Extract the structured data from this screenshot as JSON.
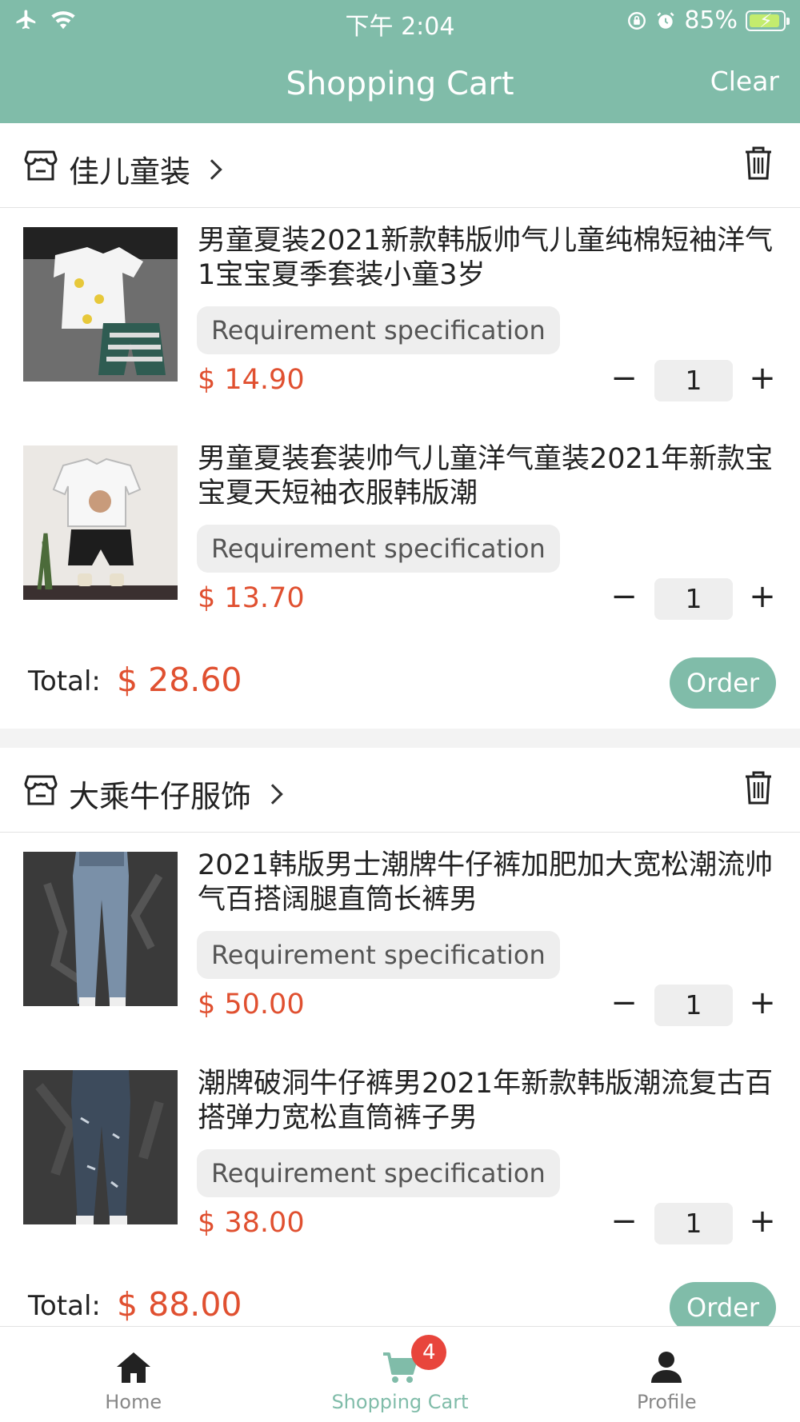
{
  "status_bar": {
    "time": "下午 2:04",
    "battery": "85%"
  },
  "header": {
    "title": "Shopping Cart",
    "clear_label": "Clear"
  },
  "stores": [
    {
      "name": "佳儿童装",
      "items": [
        {
          "title": "男童夏装2021新款韩版帅气儿童纯棉短袖洋气1宝宝夏季套装小童3岁",
          "spec": "Requirement specification",
          "price": "$ 14.90",
          "qty": "1"
        },
        {
          "title": "男童夏装套装帅气儿童洋气童装2021年新款宝宝夏天短袖衣服韩版潮",
          "spec": "Requirement specification",
          "price": "$ 13.70",
          "qty": "1"
        }
      ],
      "total_label": "Total:",
      "total": "$ 28.60",
      "order_label": "Order"
    },
    {
      "name": "大乘牛仔服饰",
      "items": [
        {
          "title": "2021韩版男士潮牌牛仔裤加肥加大宽松潮流帅气百搭阔腿直筒长裤男",
          "spec": "Requirement specification",
          "price": "$ 50.00",
          "qty": "1"
        },
        {
          "title": "潮牌破洞牛仔裤男2021年新款韩版潮流复古百搭弹力宽松直筒裤子男",
          "spec": "Requirement specification",
          "price": "$ 38.00",
          "qty": "1"
        }
      ],
      "total_label": "Total:",
      "total": "$ 88.00",
      "order_label": "Order"
    }
  ],
  "tabbar": {
    "home": "Home",
    "cart": "Shopping Cart",
    "cart_badge": "4",
    "profile": "Profile"
  },
  "colors": {
    "accent": "#80bca9",
    "price": "#e05030",
    "badge": "#e8453c"
  }
}
